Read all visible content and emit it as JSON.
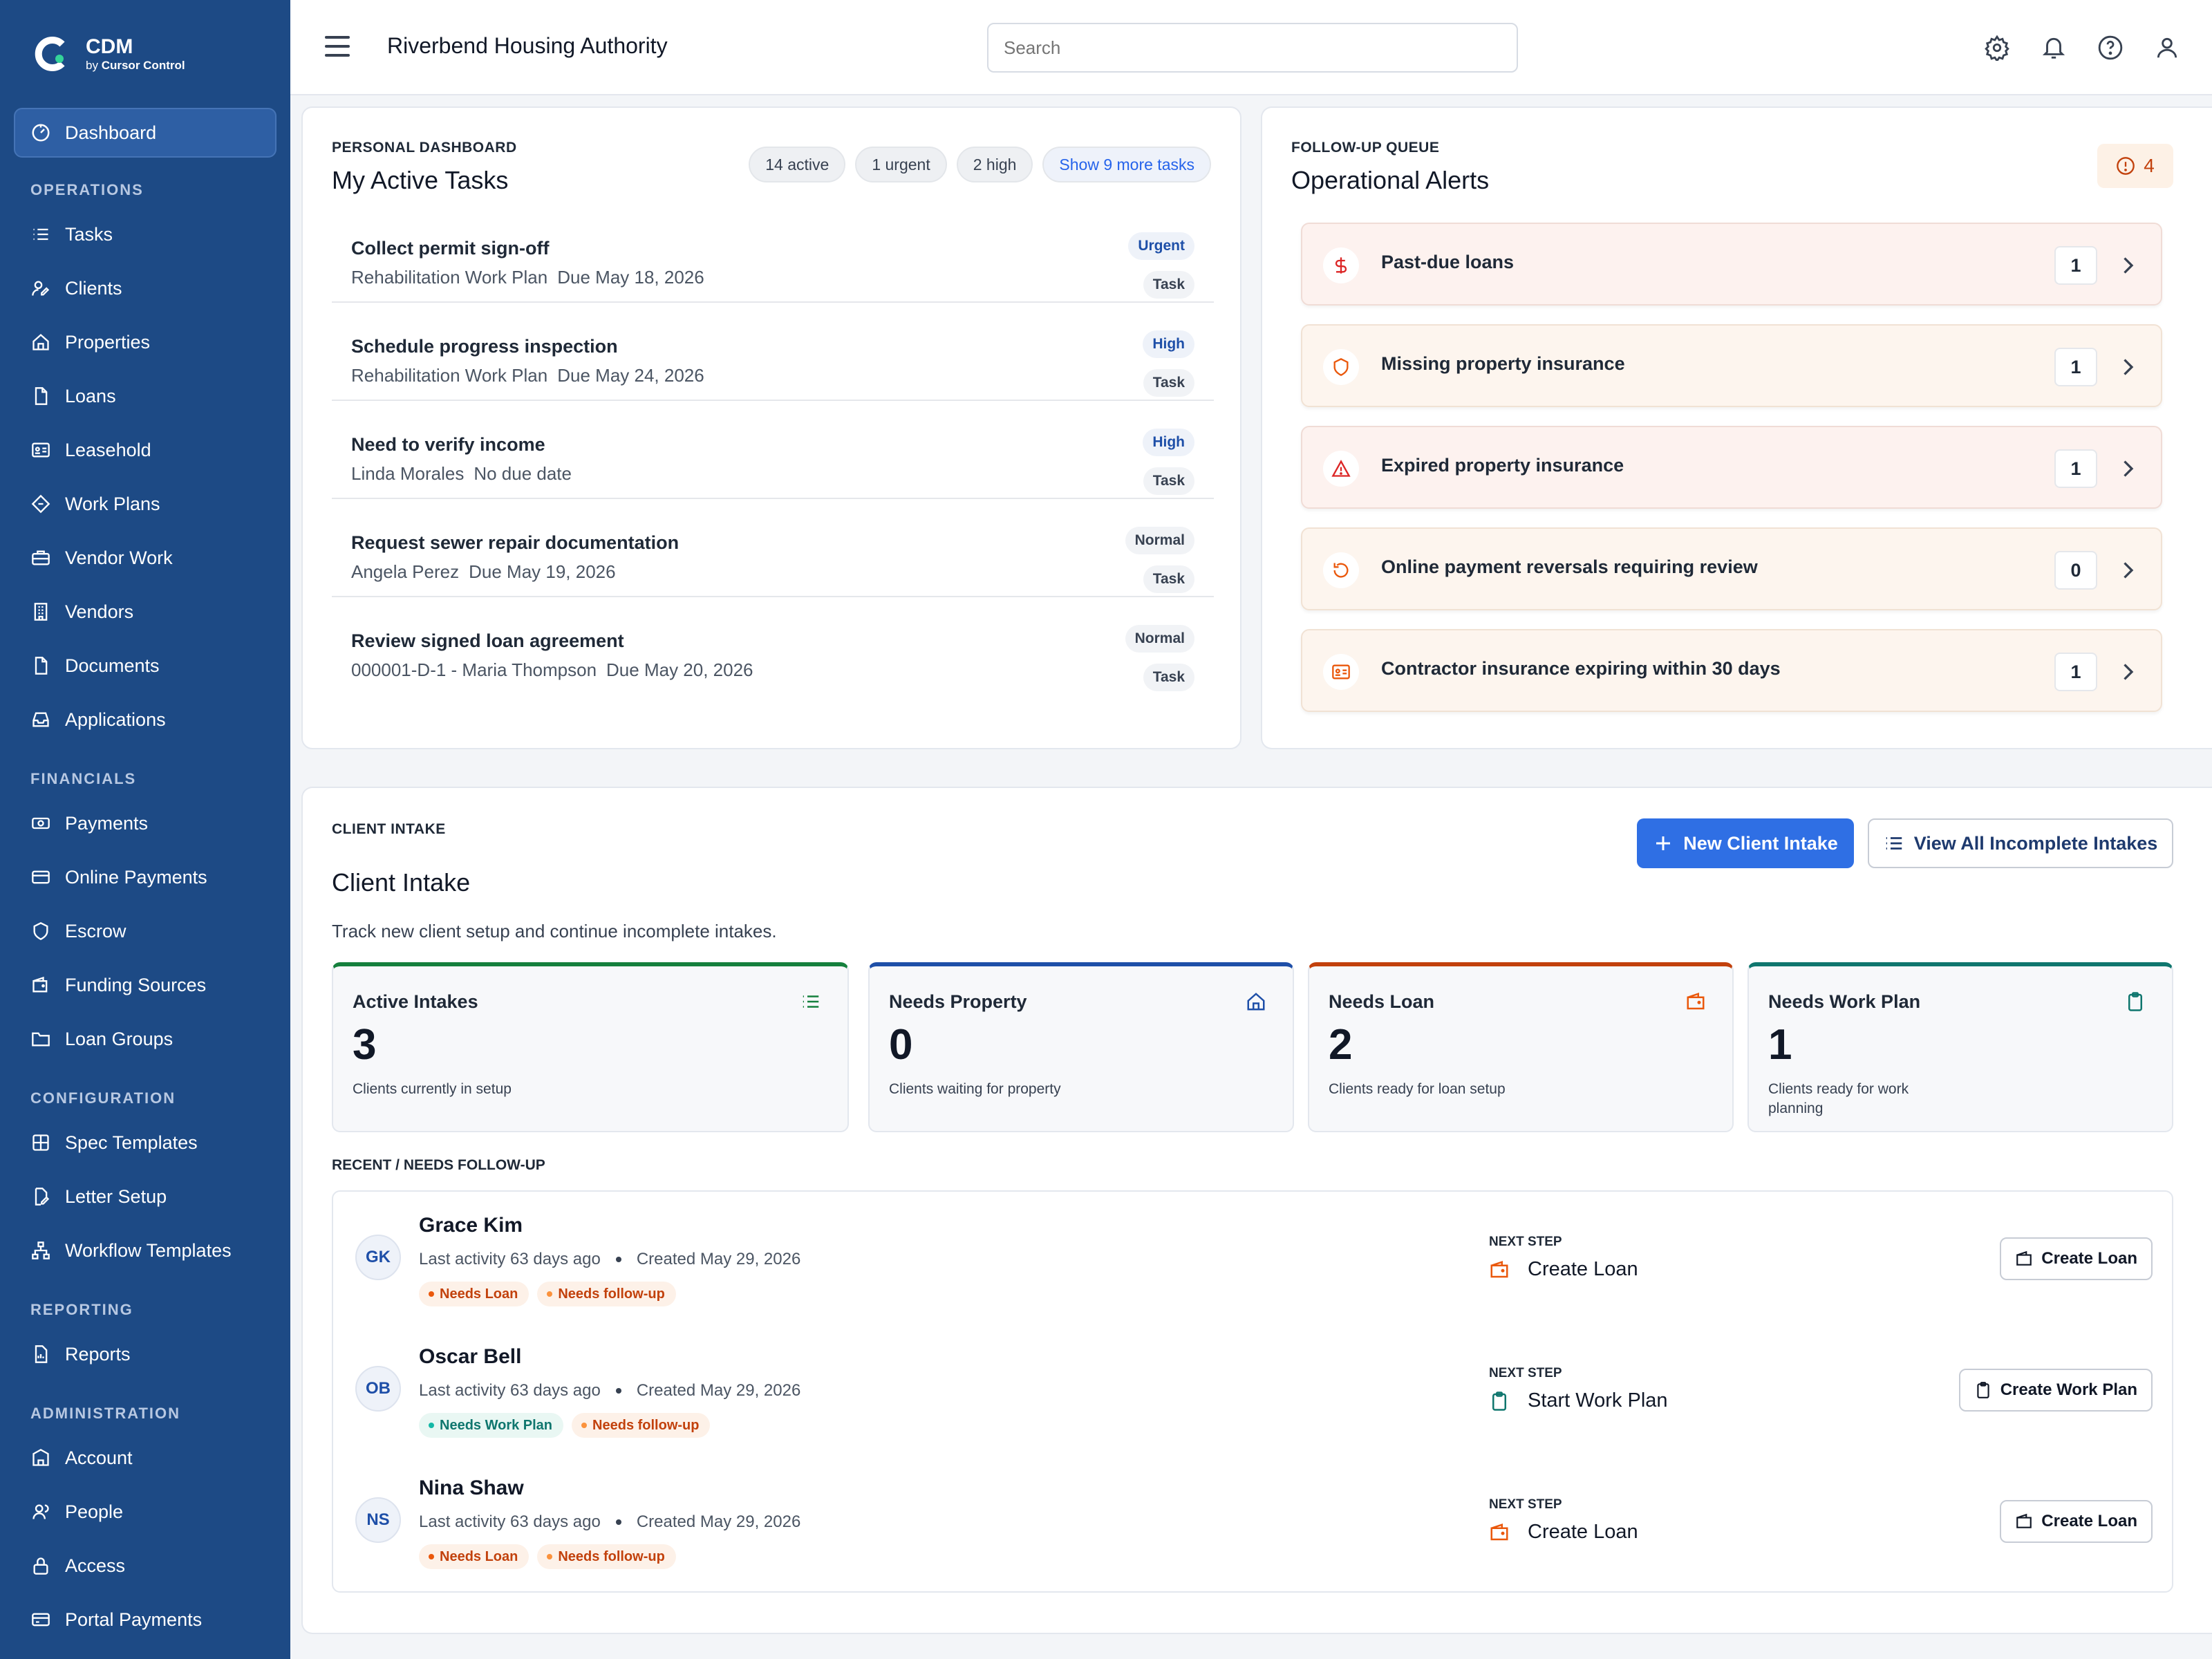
{
  "brand": {
    "name": "CDM",
    "sub_prefix": "by",
    "sub_name": "Cursor Control"
  },
  "sidebar": {
    "dashboard": {
      "label": "Dashboard",
      "icon": "dashboard-icon"
    },
    "sections": [
      {
        "title": "OPERATIONS",
        "items": [
          {
            "label": "Tasks",
            "icon": "list-icon"
          },
          {
            "label": "Clients",
            "icon": "user-edit-icon"
          },
          {
            "label": "Properties",
            "icon": "home-icon"
          },
          {
            "label": "Loans",
            "icon": "file-icon"
          },
          {
            "label": "Leasehold",
            "icon": "id-card-icon"
          },
          {
            "label": "Work Plans",
            "icon": "diamond-icon"
          },
          {
            "label": "Vendor Work",
            "icon": "briefcase-icon"
          },
          {
            "label": "Vendors",
            "icon": "building-icon"
          },
          {
            "label": "Documents",
            "icon": "document-icon"
          },
          {
            "label": "Applications",
            "icon": "inbox-icon"
          }
        ]
      },
      {
        "title": "FINANCIALS",
        "items": [
          {
            "label": "Payments",
            "icon": "banknote-icon"
          },
          {
            "label": "Online Payments",
            "icon": "credit-card-icon"
          },
          {
            "label": "Escrow",
            "icon": "shield-icon"
          },
          {
            "label": "Funding Sources",
            "icon": "wallet-icon"
          },
          {
            "label": "Loan Groups",
            "icon": "folder-icon"
          }
        ]
      },
      {
        "title": "CONFIGURATION",
        "items": [
          {
            "label": "Spec Templates",
            "icon": "grid-icon"
          },
          {
            "label": "Letter Setup",
            "icon": "file-edit-icon"
          },
          {
            "label": "Workflow Templates",
            "icon": "workflow-icon"
          }
        ]
      },
      {
        "title": "REPORTING",
        "items": [
          {
            "label": "Reports",
            "icon": "report-icon"
          }
        ]
      },
      {
        "title": "ADMINISTRATION",
        "items": [
          {
            "label": "Account",
            "icon": "account-icon"
          },
          {
            "label": "People",
            "icon": "people-icon"
          },
          {
            "label": "Access",
            "icon": "lock-icon"
          },
          {
            "label": "Portal Payments",
            "icon": "card-icon"
          }
        ]
      }
    ]
  },
  "header": {
    "title": "Riverbend Housing Authority",
    "search_placeholder": "Search"
  },
  "tasks": {
    "eyebrow": "PERSONAL DASHBOARD",
    "title": "My Active Tasks",
    "pills": [
      "14 active",
      "1 urgent",
      "2 high"
    ],
    "more_link": "Show 9 more tasks",
    "items": [
      {
        "title": "Collect permit sign-off",
        "context": "Rehabilitation Work Plan",
        "due": "Due May 18, 2026",
        "priority": "Urgent",
        "kind": "Task"
      },
      {
        "title": "Schedule progress inspection",
        "context": "Rehabilitation Work Plan",
        "due": "Due May 24, 2026",
        "priority": "High",
        "kind": "Task"
      },
      {
        "title": "Need to verify income",
        "context": "Linda Morales",
        "due": "No due date",
        "priority": "High",
        "kind": "Task"
      },
      {
        "title": "Request sewer repair documentation",
        "context": "Angela Perez",
        "due": "Due May 19, 2026",
        "priority": "Normal",
        "kind": "Task"
      },
      {
        "title": "Review signed loan agreement",
        "context": "000001-D-1 - Maria Thompson",
        "due": "Due May 20, 2026",
        "priority": "Normal",
        "kind": "Task"
      }
    ]
  },
  "alerts": {
    "eyebrow": "FOLLOW-UP QUEUE",
    "title": "Operational Alerts",
    "count": "4",
    "items": [
      {
        "label": "Past-due loans",
        "count": "1",
        "icon": "dollar-icon"
      },
      {
        "label": "Missing property insurance",
        "count": "1",
        "icon": "shield-icon"
      },
      {
        "label": "Expired property insurance",
        "count": "1",
        "icon": "warning-icon"
      },
      {
        "label": "Online payment reversals requiring review",
        "count": "0",
        "icon": "undo-icon"
      },
      {
        "label": "Contractor insurance expiring within 30 days",
        "count": "1",
        "icon": "id-card-icon"
      }
    ]
  },
  "intake": {
    "eyebrow": "CLIENT INTAKE",
    "title": "Client Intake",
    "description": "Track new client setup and continue incomplete intakes.",
    "new_button": "New Client Intake",
    "view_all_button": "View All Incomplete Intakes",
    "stats": [
      {
        "label": "Active Intakes",
        "value": "3",
        "desc": "Clients currently in setup",
        "color": "#15803d",
        "icon": "list-icon"
      },
      {
        "label": "Needs Property",
        "value": "0",
        "desc": "Clients waiting for property",
        "color": "#1e4fa8",
        "icon": "home-icon"
      },
      {
        "label": "Needs Loan",
        "value": "2",
        "desc": "Clients ready for loan setup",
        "color": "#c2410c",
        "icon": "wallet-icon"
      },
      {
        "label": "Needs Work Plan",
        "value": "1",
        "desc": "Clients ready for work planning",
        "color": "#0f766e",
        "icon": "clipboard-icon"
      }
    ],
    "recent_label": "RECENT / NEEDS FOLLOW-UP",
    "next_step_label": "NEXT STEP",
    "rows": [
      {
        "initials": "GK",
        "name": "Grace Kim",
        "activity": "Last activity 63 days ago",
        "created": "Created May 29, 2026",
        "tags": [
          "Needs Loan",
          "Needs follow-up"
        ],
        "next_step": "Create Loan",
        "action": "Create Loan"
      },
      {
        "initials": "OB",
        "name": "Oscar Bell",
        "activity": "Last activity 63 days ago",
        "created": "Created May 29, 2026",
        "tags": [
          "Needs Work Plan",
          "Needs follow-up"
        ],
        "next_step": "Start Work Plan",
        "action": "Create Work Plan"
      },
      {
        "initials": "NS",
        "name": "Nina Shaw",
        "activity": "Last activity 63 days ago",
        "created": "Created May 29, 2026",
        "tags": [
          "Needs Loan",
          "Needs follow-up"
        ],
        "next_step": "Create Loan",
        "action": "Create Loan"
      }
    ]
  },
  "colors": {
    "sidebar": "#1d4a85",
    "primary": "#2f6fe4",
    "accent_orange": "#c2410c",
    "accent_teal": "#0f766e"
  }
}
